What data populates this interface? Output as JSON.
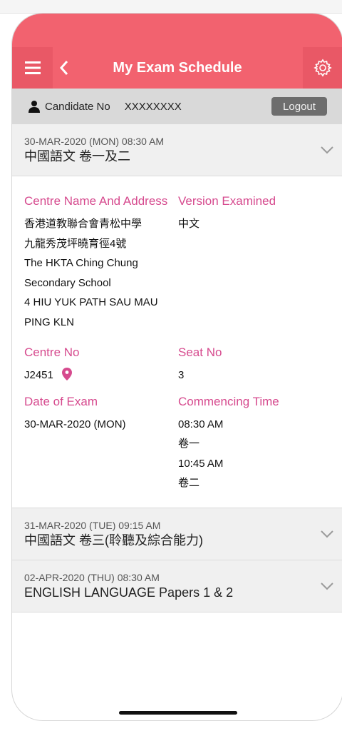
{
  "header": {
    "title": "My Exam Schedule",
    "menu_icon": "hamburger-menu-icon",
    "back_icon": "chevron-left-icon",
    "settings_icon": "gear-icon"
  },
  "candidate": {
    "label": "Candidate No",
    "number": "XXXXXXXX",
    "logout_label": "Logout"
  },
  "colors": {
    "header": "#f2626f",
    "accent_label": "#d64a8e",
    "bar": "#d9d9d9"
  },
  "exams": [
    {
      "date": "30-MAR-2020 (MON) 08:30 AM",
      "subject": "中國語文 卷一及二",
      "expanded": true,
      "details": {
        "centre_label": "Centre Name And Address",
        "centre_lines": [
          "香港道教聯合會青松中學",
          "九龍秀茂坪曉育徑4號",
          "The HKTA Ching Chung",
          "Secondary School",
          "4 HIU YUK PATH SAU MAU",
          "PING KLN"
        ],
        "version_label": "Version Examined",
        "version_value": "中文",
        "centre_no_label": "Centre No",
        "centre_no_value": "J2451",
        "seat_label": "Seat No",
        "seat_value": "3",
        "date_label": "Date of Exam",
        "date_value": "30-MAR-2020 (MON)",
        "time_label": "Commencing Time",
        "time_lines": [
          "08:30 AM",
          "卷一",
          "10:45 AM",
          "卷二"
        ]
      }
    },
    {
      "date": "31-MAR-2020 (TUE) 09:15 AM",
      "subject": "中國語文 卷三(聆聽及綜合能力)",
      "expanded": false
    },
    {
      "date": "02-APR-2020 (THU) 08:30 AM",
      "subject": "ENGLISH LANGUAGE Papers 1 & 2",
      "expanded": false
    }
  ]
}
